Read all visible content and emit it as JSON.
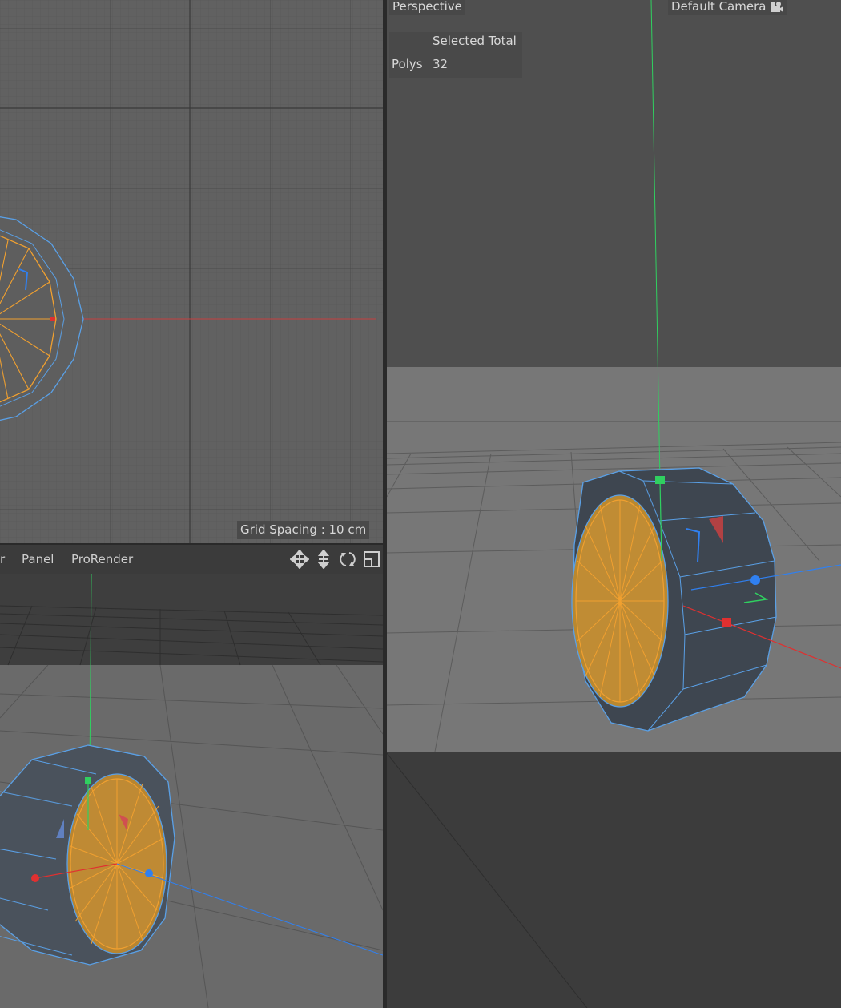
{
  "viewport_front": {
    "grid_spacing": "Grid Spacing : 10 cm"
  },
  "viewport_small_perspective": {
    "menu": {
      "items": [
        {
          "label": "r"
        },
        {
          "label": "Panel"
        },
        {
          "label": "ProRender"
        }
      ]
    },
    "nav_icons": [
      "move-view-icon",
      "zoom-view-icon",
      "rotate-view-icon",
      "toggle-layout-icon"
    ]
  },
  "viewport_perspective": {
    "view_name": "Perspective",
    "camera_label": "Default Camera",
    "camera_icon": "camera-icon",
    "stats": {
      "column_header": "Selected Total",
      "row_label": "Polys",
      "row_value": "32"
    }
  },
  "colors": {
    "selection_orange": "#f0a030",
    "edge_blue": "#5aa0e6",
    "axis_x": "#e03030",
    "axis_y": "#30d060",
    "axis_z": "#3080f0"
  }
}
